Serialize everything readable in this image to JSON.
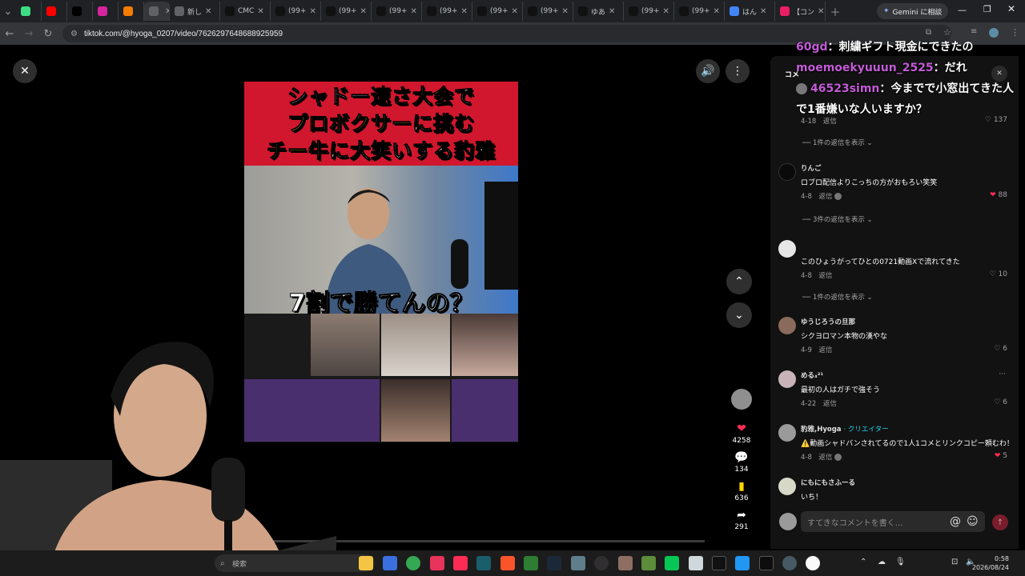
{
  "browser": {
    "tabs": [
      {
        "label": "",
        "color": "#3ddc84"
      },
      {
        "label": "",
        "color": "#ff0000"
      },
      {
        "label": "",
        "color": "#000000"
      },
      {
        "label": "",
        "color": "#d6249f"
      },
      {
        "label": "",
        "color": "#f57c00"
      },
      {
        "label": "",
        "color": "#5f6368"
      },
      {
        "label": "新し",
        "color": "#5f6368"
      },
      {
        "label": "CMC",
        "color": "#111111"
      },
      {
        "label": "(99+",
        "color": "#111111"
      },
      {
        "label": "(99+",
        "color": "#111111"
      },
      {
        "label": "(99+",
        "color": "#111111"
      },
      {
        "label": "(99+",
        "color": "#111111"
      },
      {
        "label": "(99+",
        "color": "#111111"
      },
      {
        "label": "(99+",
        "color": "#111111"
      },
      {
        "label": "ゆあ",
        "color": "#111111"
      },
      {
        "label": "(99+",
        "color": "#111111"
      },
      {
        "label": "(99+",
        "color": "#111111"
      },
      {
        "label": "はん",
        "color": "#4285f4"
      },
      {
        "label": "【コン",
        "color": "#e91e63"
      }
    ],
    "gemini_label": "Gemini に相談",
    "url": "tiktok.com/@hyoga_0207/video/7626297648688925959"
  },
  "video": {
    "banner_line1_a": "シャドー",
    "banner_line1_b": "速さ大会",
    "banner_line1_c": "で",
    "banner_line2_a": "プロボクサー",
    "banner_line2_b": "に挑む",
    "banner_line3_a": "チー牛",
    "banner_line3_b": "に大笑いする豹雅",
    "caption": "7割で勝てんの？",
    "progress": 0.02
  },
  "actions": {
    "likes": "4258",
    "comments": "134",
    "saves": "636",
    "shares": "291"
  },
  "comments": {
    "tab_label": "コメ",
    "items": [
      {
        "meta_date": "4-18",
        "reply": "返信",
        "likes": "137",
        "liked": false
      },
      {
        "user": "りんご",
        "text": "ロブロ配信よりこっちの方がおもろい笑笑",
        "meta_date": "4-8",
        "reply": "返信",
        "likes": "88",
        "liked": true
      },
      {
        "user": "",
        "text": "このひょうがってひとの0721動画Xで流れてきた",
        "meta_date": "4-8",
        "reply": "返信",
        "likes": "10",
        "liked": false
      },
      {
        "user": "ゆうじろうの旦那",
        "text": "シクヨロマン本物の漢やな",
        "meta_date": "4-9",
        "reply": "返信",
        "likes": "6",
        "liked": false
      },
      {
        "user": "める₄²¹",
        "text": "最初の人はガチで強そう",
        "meta_date": "4-22",
        "reply": "返信",
        "likes": "6",
        "liked": false
      },
      {
        "user": "豹雅,Hyoga",
        "creator": "· クリエイター",
        "text": "⚠️動画シャドバンされてるので1人1コメとリンクコピー頼むわ！",
        "meta_date": "4-8",
        "reply": "返信",
        "likes": "5",
        "liked": true
      },
      {
        "user": "にもにもさふーる",
        "text": "いち！"
      }
    ],
    "view_replies_1": "1件の返信を表示",
    "view_replies_2": "3件の返信を表示",
    "view_replies_3": "1件の返信を表示",
    "input_placeholder": "すてきなコメントを書く..."
  },
  "chat": [
    {
      "name": "60gd",
      "message": "：刺繍ギフト現金にできたの"
    },
    {
      "name": "moemoekyuuun_2525",
      "message": "：だれ"
    },
    {
      "name": "46523simn",
      "message": "：今までで小窓出てきた人"
    },
    {
      "name": "",
      "message": "で1番嫌いな人いますか？"
    }
  ],
  "taskbar": {
    "search_label": "検索",
    "time": "0:58",
    "date": "2026/08/24"
  }
}
